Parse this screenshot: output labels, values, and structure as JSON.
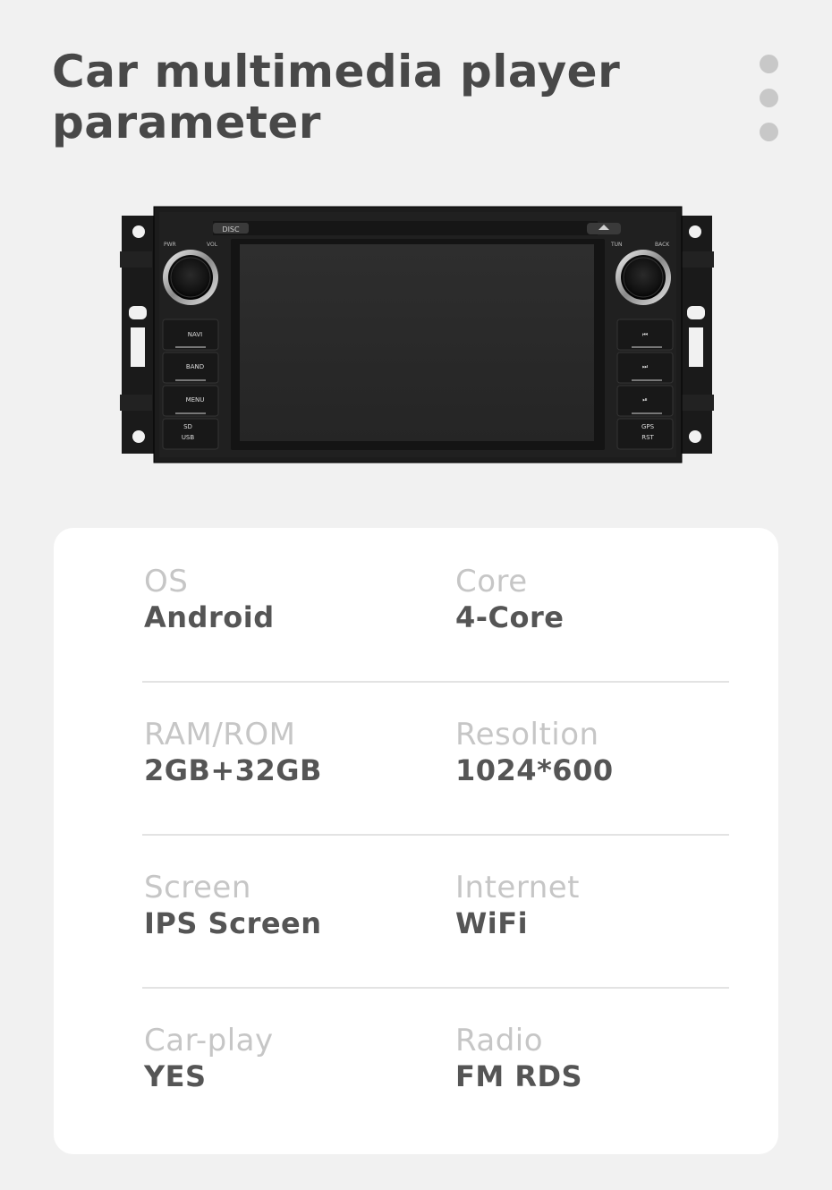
{
  "header": {
    "title_line1": "Car multimedia player",
    "title_line2": "parameter"
  },
  "menu_icon": "more-vertical-icon",
  "device": {
    "labels": {
      "disc": "DISC",
      "pwr": "PWR",
      "vol": "VOL",
      "tun": "TUN",
      "back": "BACK",
      "navi": "NAVI",
      "band": "BAND",
      "menu": "MENU",
      "sd": "SD",
      "usb": "USB",
      "gps": "GPS",
      "rst": "RST"
    },
    "colors": {
      "body": "#1c1c1c",
      "screen": "#2a2a2a"
    }
  },
  "specs": [
    {
      "left": {
        "label": "OS",
        "value": "Android"
      },
      "right": {
        "label": "Core",
        "value": "4-Core"
      }
    },
    {
      "left": {
        "label": "RAM/ROM",
        "value": "2GB+32GB"
      },
      "right": {
        "label": "Resoltion",
        "value": "1024*600"
      }
    },
    {
      "left": {
        "label": "Screen",
        "value": "IPS Screen"
      },
      "right": {
        "label": "Internet",
        "value": "WiFi"
      }
    },
    {
      "left": {
        "label": "Car-play",
        "value": "YES"
      },
      "right": {
        "label": "Radio",
        "value": "FM RDS"
      }
    }
  ]
}
